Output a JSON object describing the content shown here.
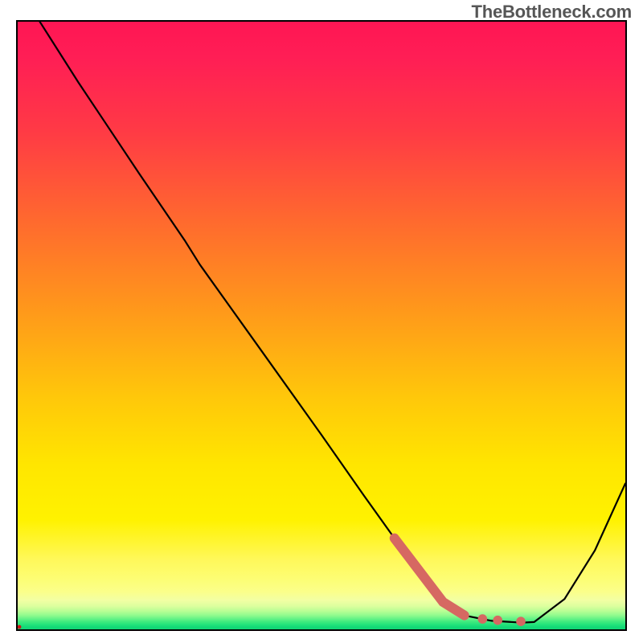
{
  "attribution": "TheBottleneck.com",
  "chart_data": {
    "type": "line",
    "title": "",
    "xlabel": "",
    "ylabel": "",
    "xlim": [
      0,
      100
    ],
    "ylim": [
      0,
      100
    ],
    "series": [
      {
        "name": "bottleneck-curve",
        "x": [
          3,
          10,
          20,
          27.5,
          30,
          40,
          50,
          57,
          62,
          70,
          74,
          78,
          83,
          85,
          90,
          95,
          100
        ],
        "values": [
          101,
          90,
          75,
          64,
          60,
          46,
          32,
          22,
          15,
          4.5,
          2.2,
          1.4,
          1.1,
          1.2,
          5,
          13,
          24
        ]
      },
      {
        "name": "marker-stroke",
        "x": [
          62,
          70,
          73.5
        ],
        "values": [
          15,
          4.5,
          2.3
        ]
      }
    ],
    "markers": [
      {
        "name": "marker-dot-a",
        "x": 76.5,
        "value": 1.7
      },
      {
        "name": "marker-dot-b",
        "x": 79.0,
        "value": 1.5
      },
      {
        "name": "marker-dot-c",
        "x": 82.8,
        "value": 1.3
      }
    ]
  },
  "style": {
    "marker_color": "#d66862",
    "curve_color": "#000000"
  }
}
